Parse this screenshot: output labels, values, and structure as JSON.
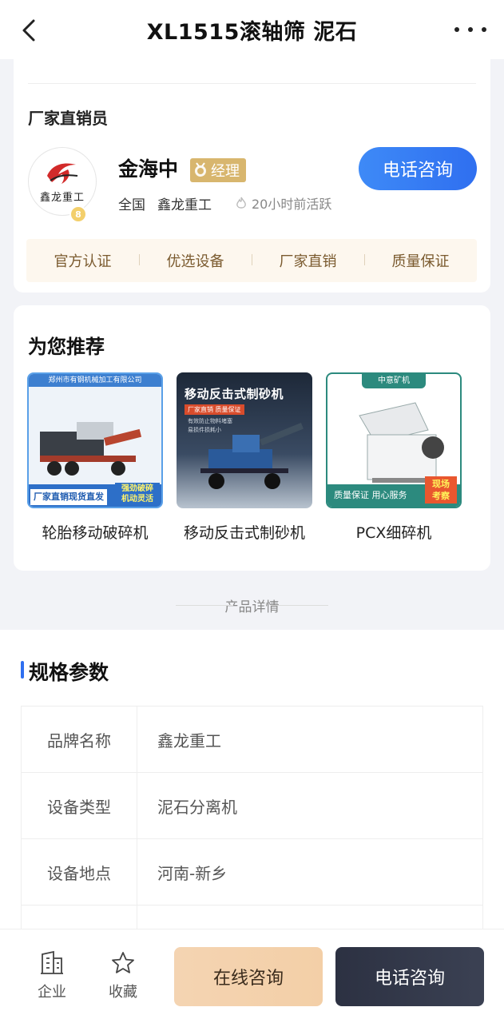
{
  "header": {
    "title": "XL1515滚轴筛 泥石"
  },
  "seller": {
    "section_label": "厂家直销员",
    "avatar_text": "鑫龙重工",
    "level_badge": "8",
    "name": "金海中",
    "role": "经理",
    "location": "全国",
    "company": "鑫龙重工",
    "active": "20小时前活跃",
    "call_label": "电话咨询",
    "tags": [
      "官方认证",
      "优选设备",
      "厂家直销",
      "质量保证"
    ]
  },
  "recommend": {
    "heading": "为您推荐",
    "items": [
      {
        "name": "轮胎移动破碎机",
        "thumb_header": "郑州市有钢机械加工有限公司",
        "thumb_footer_left": "厂家直销现货直发",
        "thumb_footer_right": [
          "强劲破碎",
          "机动灵活"
        ]
      },
      {
        "name": "移动反击式制砂机",
        "thumb_title": "移动反击式制砂机",
        "thumb_tag": "厂家直销 质量保证",
        "thumb_lines": [
          "有效防止物料堵塞",
          "易损件损耗小"
        ]
      },
      {
        "name": "PCX细碎机",
        "thumb_header": "中意矿机",
        "thumb_footer": "质量保证 用心服务",
        "thumb_stamp": [
          "现场",
          "考察"
        ]
      }
    ]
  },
  "divider_label": "产品详情",
  "specs": {
    "heading": "规格参数",
    "rows": [
      {
        "k": "品牌名称",
        "v": "鑫龙重工"
      },
      {
        "k": "设备类型",
        "v": "泥石分离机"
      },
      {
        "k": "设备地点",
        "v": "河南-新乡"
      }
    ]
  },
  "bottom": {
    "enterprise_label": "企业",
    "favorite_label": "收藏",
    "online_label": "在线咨询",
    "phone_label": "电话咨询"
  }
}
